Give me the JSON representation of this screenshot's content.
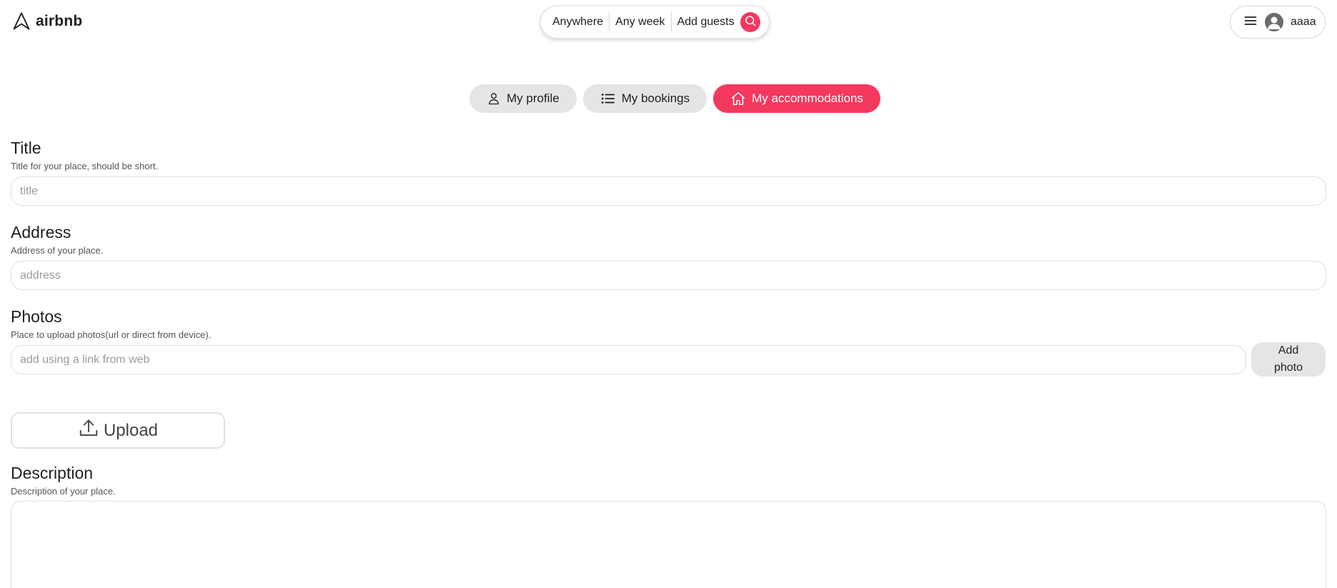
{
  "brand": {
    "name": "airbnb",
    "accent_color": "#f5385d"
  },
  "header": {
    "search": {
      "anywhere": "Anywhere",
      "any_week": "Any week",
      "add_guests": "Add guests"
    },
    "user": {
      "name": "aaaa"
    }
  },
  "tabs": [
    {
      "label": "My profile",
      "icon": "user-icon",
      "active": false
    },
    {
      "label": "My bookings",
      "icon": "list-icon",
      "active": false
    },
    {
      "label": "My accommodations",
      "icon": "home-icon",
      "active": true
    }
  ],
  "form": {
    "title": {
      "heading": "Title",
      "help": "Title for your place, should be short.",
      "placeholder": "title",
      "value": ""
    },
    "address": {
      "heading": "Address",
      "help": "Address of your place.",
      "placeholder": "address",
      "value": ""
    },
    "photos": {
      "heading": "Photos",
      "help": "Place to upload photos(url or direct from device).",
      "placeholder": "add using a link from web",
      "add_button": "Add photo",
      "upload_button": "Upload"
    },
    "description": {
      "heading": "Description",
      "help": "Description of your place.",
      "value": ""
    }
  }
}
